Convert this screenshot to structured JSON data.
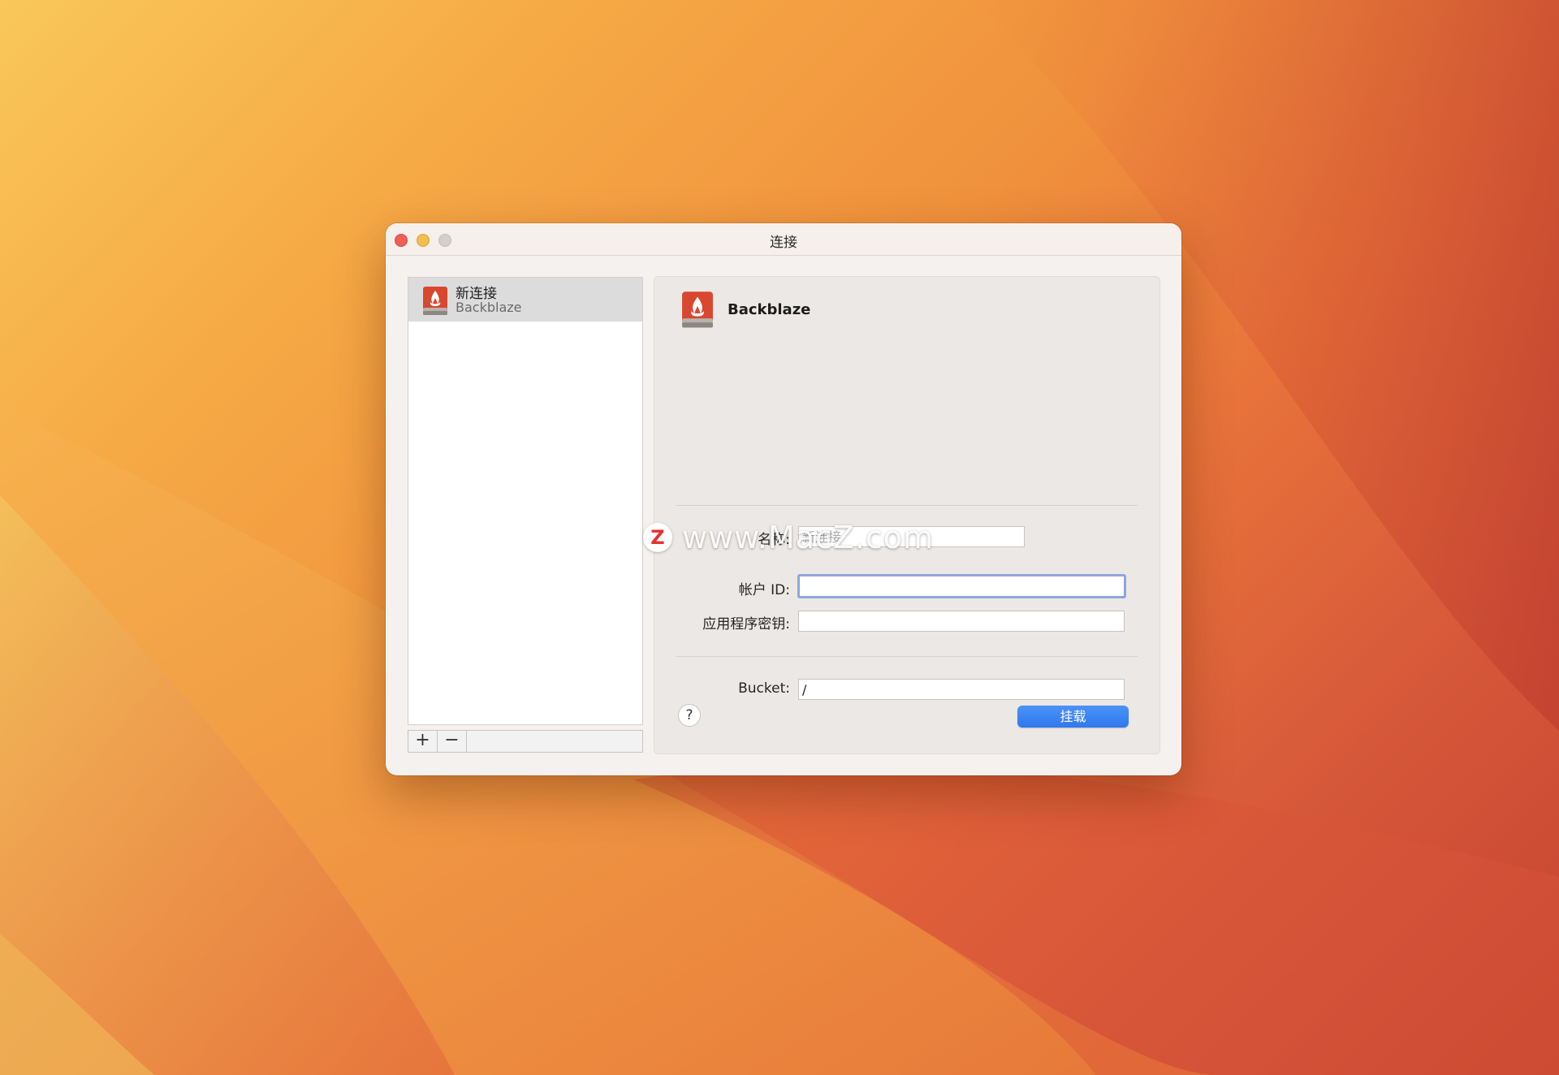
{
  "window": {
    "title": "连接"
  },
  "sidebar": {
    "items": [
      {
        "title": "新连接",
        "subtitle": "Backblaze",
        "icon": "backblaze-drive-icon",
        "selected": true
      }
    ],
    "add_label": "+",
    "remove_label": "−"
  },
  "panel": {
    "heading": "Backblaze",
    "icon": "backblaze-drive-icon",
    "fields": {
      "name_label": "名称:",
      "name_placeholder": "新连接",
      "name_value": "",
      "account_label": "帐户 ID:",
      "account_value": "",
      "appkey_label": "应用程序密钥:",
      "appkey_value": "",
      "bucket_label": "Bucket:",
      "bucket_value": "/"
    },
    "help_label": "?",
    "mount_label": "挂载"
  },
  "watermark": {
    "badge": "Z",
    "text": "www.MacZ.com"
  },
  "colors": {
    "accent": "#2f78ee",
    "brand_red": "#d9472f",
    "close": "#ee5f58",
    "minimize": "#f3bd4f"
  }
}
